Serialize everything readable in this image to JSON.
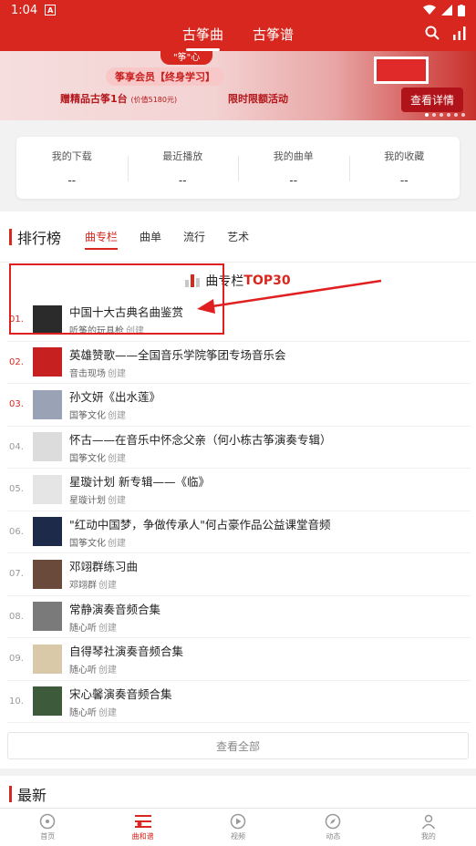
{
  "status_bar": {
    "time": "1:04"
  },
  "header": {
    "tabs": [
      "古筝曲",
      "古筝谱"
    ]
  },
  "banner": {
    "topline": "\"筝\"心",
    "tag": "筝享会员【终身学习】",
    "offer": "赠精品古筝1台",
    "offer_price": "(价值5180元)",
    "limited": "限时限额活动",
    "detail_button": "查看详情"
  },
  "stats": [
    {
      "label": "我的下载",
      "value": "--"
    },
    {
      "label": "最近播放",
      "value": "--"
    },
    {
      "label": "我的曲单",
      "value": "--"
    },
    {
      "label": "我的收藏",
      "value": "--"
    }
  ],
  "ranking": {
    "title": "排行榜",
    "tabs": [
      "曲专栏",
      "曲单",
      "流行",
      "艺术"
    ],
    "section_title_prefix": "曲专栏",
    "section_title_suffix": "TOP30",
    "created_label": "创建",
    "items": [
      {
        "rank": "01.",
        "name": "中国十大古典名曲鉴赏",
        "author": "听筝的玩具枪",
        "cover": "#2b2b2b"
      },
      {
        "rank": "02.",
        "name": "英雄赞歌——全国音乐学院筝团专场音乐会",
        "author": "音击现场",
        "cover": "#c62020"
      },
      {
        "rank": "03.",
        "name": "孙文妍《出水莲》",
        "author": "国筝文化",
        "cover": "#9aa3b5"
      },
      {
        "rank": "04.",
        "name": "怀古——在音乐中怀念父亲（何小栋古筝演奏专辑）",
        "author": "国筝文化",
        "cover": "#dcdcdc"
      },
      {
        "rank": "05.",
        "name": "星璇计划 新专辑——《临》",
        "author": "星璇计划",
        "cover": "#e5e5e5"
      },
      {
        "rank": "06.",
        "name": "\"红动中国梦，争做传承人\"何占豪作品公益课堂音频",
        "author": "国筝文化",
        "cover": "#1d2a4a"
      },
      {
        "rank": "07.",
        "name": "邓翊群练习曲",
        "author": "邓翊群",
        "cover": "#6a4a3a"
      },
      {
        "rank": "08.",
        "name": "常静演奏音频合集",
        "author": "随心听",
        "cover": "#7a7a7a"
      },
      {
        "rank": "09.",
        "name": "自得琴社演奏音频合集",
        "author": "随心听",
        "cover": "#d9c9a8"
      },
      {
        "rank": "10.",
        "name": "宋心馨演奏音频合集",
        "author": "随心听",
        "cover": "#3d5a3a"
      }
    ],
    "view_all": "查看全部"
  },
  "latest": {
    "title": "最新"
  },
  "tabbar": [
    {
      "label": "首页",
      "icon": "disc-icon"
    },
    {
      "label": "曲和谱",
      "icon": "music-score-icon"
    },
    {
      "label": "视频",
      "icon": "video-icon"
    },
    {
      "label": "动态",
      "icon": "compass-icon"
    },
    {
      "label": "我的",
      "icon": "user-icon"
    }
  ],
  "colors": {
    "brand": "#d7271e",
    "annotation": "#e02020"
  }
}
